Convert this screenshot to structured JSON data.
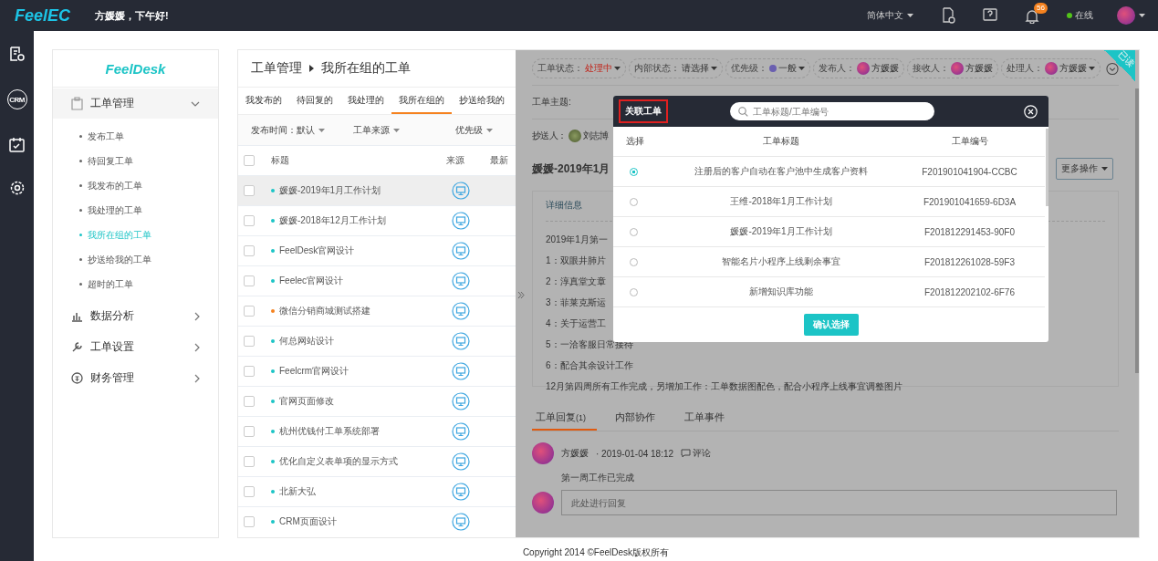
{
  "topbar": {
    "logo": "FeelEC",
    "greeting": "方媛媛，下午好!",
    "language": "简体中文",
    "notification_count": "56",
    "status": "在线",
    "online": true
  },
  "rail_items": [
    {
      "kind": "ticket"
    },
    {
      "kind": "crm",
      "label": "CRM"
    },
    {
      "kind": "calendar"
    },
    {
      "kind": "settings"
    }
  ],
  "sidebar": {
    "logo": "FeelDesk",
    "groups": [
      {
        "label": "工单管理",
        "kind": "ticket",
        "expanded": true,
        "children": [
          {
            "label": "发布工单",
            "selected": false
          },
          {
            "label": "待回复工单",
            "selected": false
          },
          {
            "label": "我发布的工单",
            "selected": false
          },
          {
            "label": "我处理的工单",
            "selected": false
          },
          {
            "label": "我所在组的工单",
            "selected": true
          },
          {
            "label": "抄送给我的工单",
            "selected": false
          },
          {
            "label": "超时的工单",
            "selected": false
          }
        ]
      },
      {
        "label": "数据分析",
        "kind": "chart",
        "expanded": false
      },
      {
        "label": "工单设置",
        "kind": "wrench",
        "expanded": false
      },
      {
        "label": "财务管理",
        "kind": "finance",
        "expanded": false
      }
    ]
  },
  "list": {
    "breadcrumb": [
      "工单管理",
      "我所在组的工单"
    ],
    "tabs": [
      {
        "label": "我发布的",
        "selected": false
      },
      {
        "label": "待回复的",
        "selected": false
      },
      {
        "label": "我处理的",
        "selected": false
      },
      {
        "label": "我所在组的",
        "selected": true
      },
      {
        "label": "抄送给我的",
        "selected": false
      }
    ],
    "filters": [
      "发布时间：默认",
      "工单来源",
      "优先级"
    ],
    "columns": [
      "标题",
      "来源",
      "最新"
    ],
    "all_checked": false,
    "rows": [
      {
        "title": "媛媛-2019年1月工作计划",
        "color": "#1cc4c6",
        "selected": true
      },
      {
        "title": "媛媛-2018年12月工作计划",
        "color": "#1cc4c6",
        "selected": false
      },
      {
        "title": "FeelDesk官网设计",
        "color": "#1cc4c6",
        "selected": false
      },
      {
        "title": "Feelec官网设计",
        "color": "#1cc4c6",
        "selected": false
      },
      {
        "title": "微信分销商城测试搭建",
        "color": "#f5821f",
        "selected": false
      },
      {
        "title": "何总网站设计",
        "color": "#1cc4c6",
        "selected": false
      },
      {
        "title": "Feelcrm官网设计",
        "color": "#1cc4c6",
        "selected": false
      },
      {
        "title": "官网页面修改",
        "color": "#1cc4c6",
        "selected": false
      },
      {
        "title": "杭州优钱付工单系统部署",
        "color": "#1cc4c6",
        "selected": false
      },
      {
        "title": "优化自定义表单项的显示方式",
        "color": "#1cc4c6",
        "selected": false
      },
      {
        "title": "北新大弘",
        "color": "#1cc4c6",
        "selected": false
      },
      {
        "title": "CRM页面设计",
        "color": "#1cc4c6",
        "selected": false
      }
    ]
  },
  "detail": {
    "ribbon": "已读",
    "pills": [
      {
        "kind": "status",
        "label": "工单状态：",
        "value": "处理中",
        "dropdown": true
      },
      {
        "kind": "text",
        "label": "内部状态：",
        "value": "请选择",
        "dropdown": true
      },
      {
        "kind": "priority",
        "label": "优先级：",
        "value": "一般",
        "color": "#6a5fb0",
        "dropdown": true
      },
      {
        "kind": "person",
        "label": "发布人：",
        "value": "方媛媛",
        "dropdown": false
      },
      {
        "kind": "person",
        "label": "接收人：",
        "value": "方媛媛",
        "dropdown": false
      },
      {
        "kind": "person",
        "label": "处理人：",
        "value": "方媛媛",
        "dropdown": true
      }
    ],
    "subject_label": "工单主题:",
    "cc_label": "抄送人：",
    "cc_person": "刘志博",
    "title": "媛媛-2019年1月",
    "more_button": "更多操作",
    "info_title": "详细信息",
    "info_lines": [
      "2019年1月第一",
      "1：双眼井肺片",
      "2：淳真堂文章",
      "3：菲莱克斯运",
      "4：关于运营工",
      "5：一洽客服日常接待",
      "6：配合其余设计工作",
      "12月第四周所有工作完成，另增加工作：工单数据图配色，配合小程序上线事宜调整图片"
    ],
    "reply_tabs": [
      {
        "label": "工单回复",
        "count": "(1)",
        "selected": true
      },
      {
        "label": "内部协作",
        "selected": false
      },
      {
        "label": "工单事件",
        "selected": false
      }
    ],
    "reply": {
      "author": "方媛媛",
      "time": "· 2019-01-04 18:12",
      "comment": "评论",
      "body": "第一周工作已完成"
    },
    "reply_placeholder": "此处进行回复"
  },
  "modal": {
    "title": "关联工单",
    "search_placeholder": "工单标题/工单编号",
    "columns": [
      "选择",
      "工单标题",
      "工单编号"
    ],
    "rows": [
      {
        "title": "注册后的客户自动在客户池中生成客户资料",
        "number": "F201901041904-CCBC",
        "selected": true
      },
      {
        "title": "王维-2018年1月工作计划",
        "number": "F201901041659-6D3A",
        "selected": false
      },
      {
        "title": "媛媛-2019年1月工作计划",
        "number": "F201812291453-90F0",
        "selected": false
      },
      {
        "title": "智能名片小程序上线剩余事宜",
        "number": "F201812261028-59F3",
        "selected": false
      },
      {
        "title": "新增知识库功能",
        "number": "F201812202102-6F76",
        "selected": false
      }
    ],
    "confirm": "确认选择"
  },
  "footer": "Copyright 2014 ©FeelDesk版权所有"
}
